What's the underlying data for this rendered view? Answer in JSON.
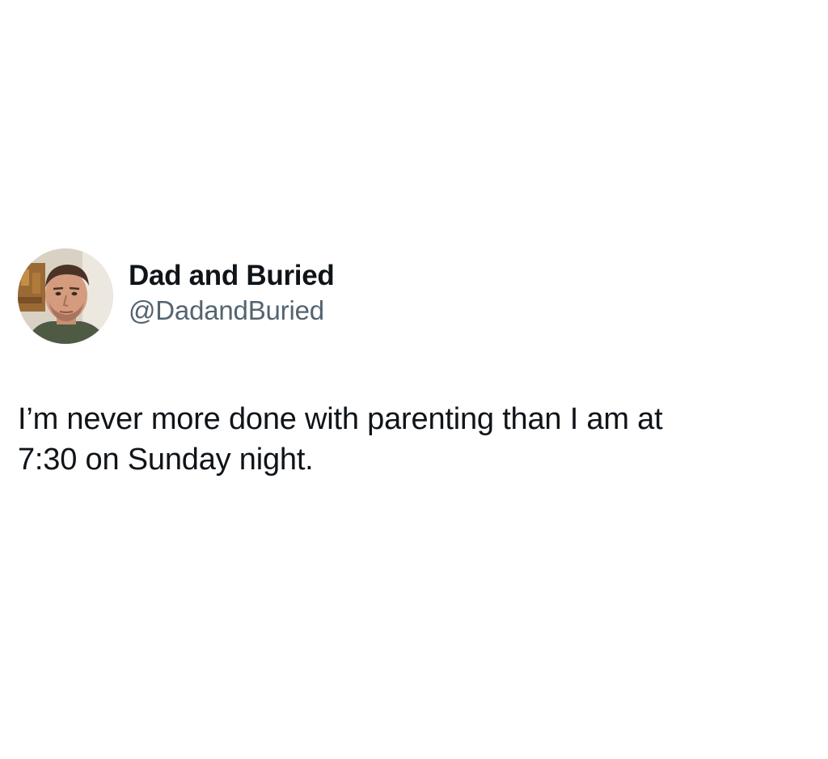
{
  "tweet": {
    "author": {
      "display_name": "Dad and Buried",
      "handle": "@DadandBuried",
      "avatar_icon": "profile-photo-avatar"
    },
    "text_line_1": "I’m never more done with parenting than I am at",
    "text_line_2": "7:30 on Sunday night."
  },
  "colors": {
    "background": "#ffffff",
    "primary_text": "#0f1419",
    "secondary_text": "#536471"
  }
}
